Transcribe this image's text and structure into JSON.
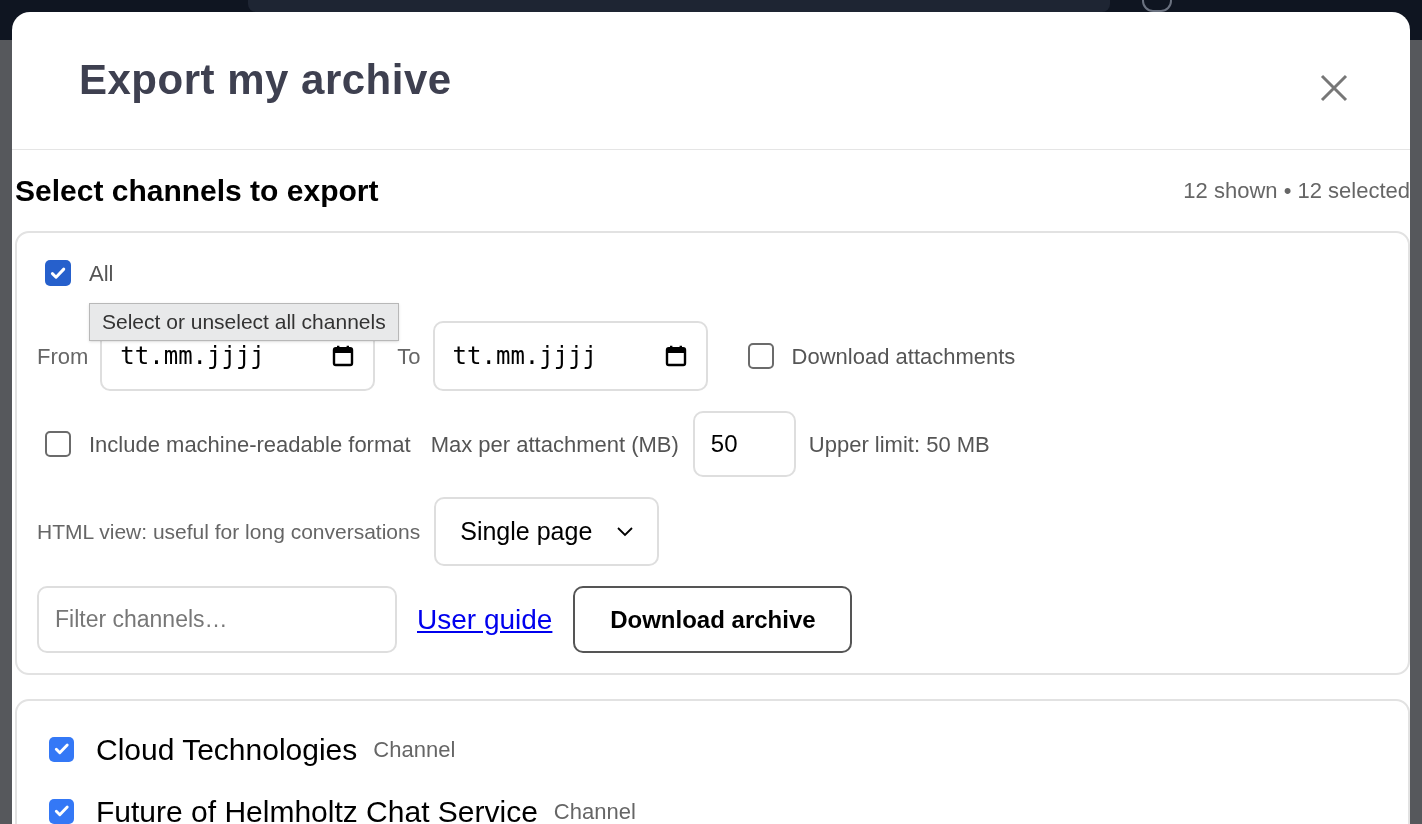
{
  "dialog": {
    "title": "Export my archive"
  },
  "section": {
    "title": "Select channels to export",
    "summary": "12 shown • 12 selected"
  },
  "all_option": {
    "label": "All",
    "checked": true
  },
  "tooltip": "Select or unselect all channels",
  "date_from": {
    "label": "From",
    "placeholder": "tt.mm.jjjj"
  },
  "date_to": {
    "label": "To",
    "placeholder": "tt.mm.jjjj"
  },
  "download_attachments": {
    "label": "Download attachments",
    "checked": false
  },
  "machine_readable": {
    "label": "Include machine-readable format",
    "checked": false
  },
  "max_attachment": {
    "label": "Max per attachment (MB)",
    "value": "50",
    "hint": "Upper limit: 50 MB"
  },
  "html_view": {
    "label": "HTML view: useful for long conversations",
    "value": "Single page"
  },
  "filter": {
    "placeholder": "Filter channels…"
  },
  "user_guide": "User guide",
  "download_button": "Download archive",
  "channels": [
    {
      "name": "Cloud Technologies",
      "type": "Channel",
      "checked": true
    },
    {
      "name": "Future of Helmholtz Chat Service",
      "type": "Channel",
      "checked": true
    }
  ]
}
